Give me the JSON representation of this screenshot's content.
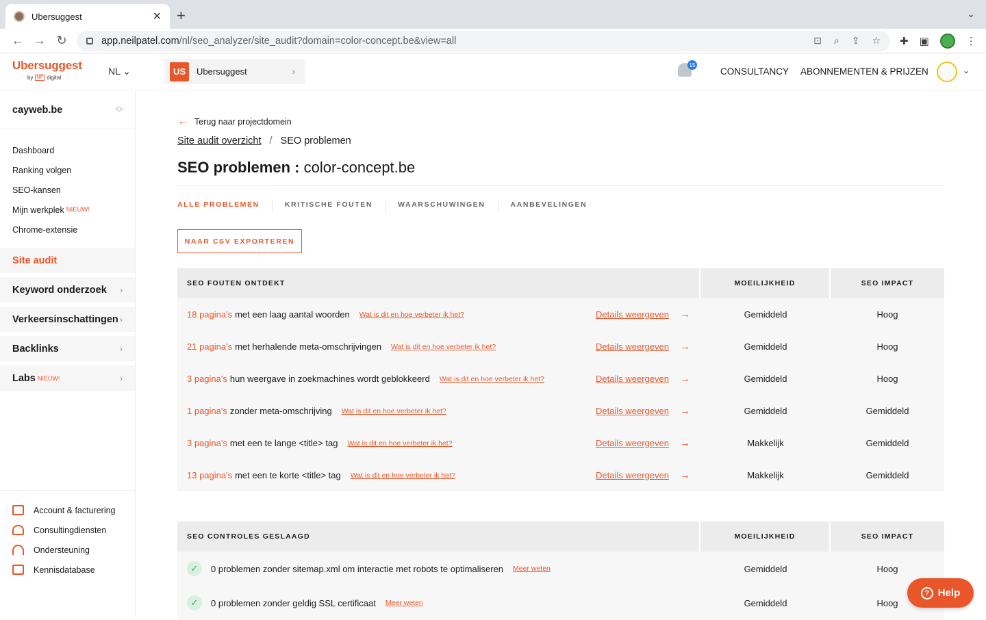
{
  "browser": {
    "tab_title": "Ubersuggest",
    "url_host": "app.neilpatel.com",
    "url_path": "/nl/seo_analyzer/site_audit?domain=color-concept.be&view=all"
  },
  "header": {
    "brand": "Ubersuggest",
    "by": "by",
    "np_mark": "NP",
    "np_text": "digital",
    "lang": "NL",
    "project_badge": "US",
    "project_name": "Ubersuggest",
    "notif_count": "15",
    "nav_consultancy": "CONSULTANCY",
    "nav_pricing": "ABONNEMENTEN & PRIJZEN"
  },
  "sidebar": {
    "domain": "cayweb.be",
    "links": [
      {
        "label": "Dashboard"
      },
      {
        "label": "Ranking volgen"
      },
      {
        "label": "SEO-kansen"
      },
      {
        "label": "Mijn werkplek",
        "badge": "NIEUW!"
      },
      {
        "label": "Chrome-extensie"
      }
    ],
    "active_section": "Site audit",
    "sections": [
      {
        "label": "Keyword onderzoek"
      },
      {
        "label": "Verkeersinschattingen"
      },
      {
        "label": "Backlinks"
      },
      {
        "label": "Labs",
        "badge": "NIEUW!"
      }
    ],
    "footer": [
      {
        "label": "Account & facturering"
      },
      {
        "label": "Consultingdiensten"
      },
      {
        "label": "Ondersteuning"
      },
      {
        "label": "Kennisdatabase"
      }
    ]
  },
  "main": {
    "back": "Terug naar projectdomein",
    "crumb_link": "Site audit overzicht",
    "crumb_sep": "/",
    "crumb_current": "SEO problemen",
    "title": "SEO problemen :",
    "title_domain": "color-concept.be",
    "tabs": [
      "ALLE PROBLEMEN",
      "KRITISCHE FOUTEN",
      "WAARSCHUWINGEN",
      "AANBEVELINGEN"
    ],
    "csv": "NAAR CSV EXPORTEREN",
    "errors_table": {
      "h1": "SEO FOUTEN ONTDEKT",
      "h2": "MOEILIJKHEID",
      "h3": "SEO IMPACT",
      "help": "Wat is dit en hoe verbeter ik het?",
      "details": "Details weergeven",
      "rows": [
        {
          "count": "18 pagina's",
          "text": "met een laag aantal woorden",
          "difficulty": "Gemiddeld",
          "impact": "Hoog"
        },
        {
          "count": "21 pagina's",
          "text": "met herhalende meta-omschrijvingen",
          "difficulty": "Gemiddeld",
          "impact": "Hoog"
        },
        {
          "count": "3 pagina's",
          "text": "hun weergave in zoekmachines wordt geblokkeerd",
          "difficulty": "Gemiddeld",
          "impact": "Hoog"
        },
        {
          "count": "1 pagina's",
          "text": "zonder meta-omschrijving",
          "difficulty": "Gemiddeld",
          "impact": "Gemiddeld"
        },
        {
          "count": "3 pagina's",
          "text": "met een te lange <title> tag",
          "difficulty": "Makkelijk",
          "impact": "Gemiddeld"
        },
        {
          "count": "13 pagina's",
          "text": "met een te korte <title> tag",
          "difficulty": "Makkelijk",
          "impact": "Gemiddeld"
        }
      ]
    },
    "passed_table": {
      "h1": "SEO CONTROLES GESLAAGD",
      "h2": "MOEILIJKHEID",
      "h3": "SEO IMPACT",
      "more": "Meer weten",
      "rows": [
        {
          "text": "0 problemen zonder sitemap.xml om interactie met robots te optimaliseren",
          "difficulty": "Gemiddeld",
          "impact": "Hoog"
        },
        {
          "text": "0 problemen zonder geldig SSL certificaat",
          "difficulty": "Gemiddeld",
          "impact": "Hoog"
        }
      ]
    }
  },
  "help_button": "Help",
  "colors": {
    "accent": "#e8562a",
    "check": "#27ae60"
  }
}
